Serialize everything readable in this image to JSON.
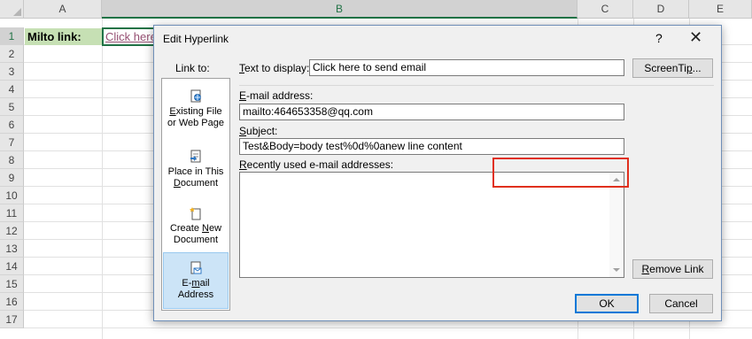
{
  "sheet": {
    "columns": [
      "A",
      "B",
      "C",
      "D",
      "E"
    ],
    "rows": [
      "1",
      "2",
      "3",
      "4",
      "5",
      "6",
      "7",
      "8",
      "9",
      "10",
      "11",
      "12",
      "13",
      "14",
      "15",
      "16",
      "17"
    ],
    "cell_a1": "Milto link:",
    "cell_b1": "Click here"
  },
  "dialog": {
    "title": "Edit Hyperlink",
    "help": "?",
    "close": "✕",
    "link_to_label": "Link to:",
    "link_to_items": [
      {
        "pre": "",
        "acc": "E",
        "post": "xisting File or Web Page",
        "line1_pre": "",
        "line1_acc": "E",
        "line1_post": "xisting File",
        "line2": "or Web Page"
      },
      {
        "line1": "Place in This",
        "line2_pre": "",
        "line2_acc": "D",
        "line2_post": "ocument"
      },
      {
        "line1_pre": "Create ",
        "line1_acc": "N",
        "line1_post": "ew",
        "line2": "Document"
      },
      {
        "line1_pre": "E-",
        "line1_acc": "m",
        "line1_post": "ail",
        "line2": "Address"
      }
    ],
    "text_to_display_label_acc": "T",
    "text_to_display_label_rest": "ext to display:",
    "text_to_display_value": "Click here to send email",
    "screentip_pre": "ScreenTi",
    "screentip_acc": "p",
    "screentip_post": "...",
    "email_label_acc": "E",
    "email_label_rest": "-mail address:",
    "email_value": "mailto:464653358@qq.com",
    "subject_label_acc": "S",
    "subject_label_rest": "ubject:",
    "subject_value": "Test&Body=body test%0d%0anew line content",
    "recent_label_acc": "R",
    "recent_label_rest": "ecently used e-mail addresses:",
    "remove_link_acc": "R",
    "remove_link_rest": "emove Link",
    "ok": "OK",
    "cancel": "Cancel",
    "highlight_color": "#e0301e",
    "selected_tab_color": "#cce4f7"
  }
}
